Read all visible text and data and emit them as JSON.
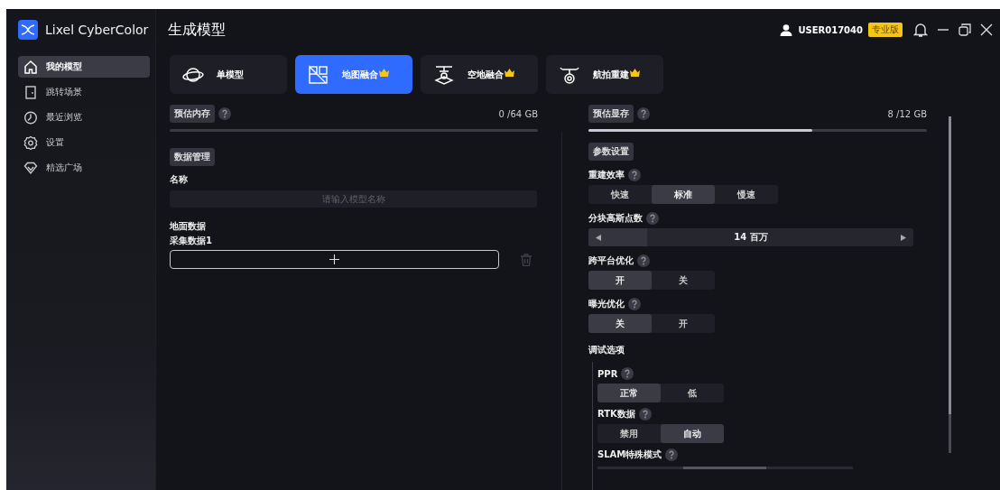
{
  "app": {
    "name": "Lixel CyberColor"
  },
  "page_title": "生成模型",
  "user": {
    "name": "USER017040",
    "badge": "专业版"
  },
  "sidebar": {
    "items": [
      {
        "label": "我的模型",
        "selected": true
      },
      {
        "label": "跳转场景",
        "selected": false
      },
      {
        "label": "最近浏览",
        "selected": false
      },
      {
        "label": "设置",
        "selected": false
      },
      {
        "label": "精选广场",
        "selected": false
      }
    ]
  },
  "mode_tabs": [
    {
      "label": "单模型",
      "selected": false,
      "premium": false
    },
    {
      "label": "地图融合",
      "selected": true,
      "premium": true
    },
    {
      "label": "空地融合",
      "selected": false,
      "premium": true
    },
    {
      "label": "航拍重建",
      "selected": false,
      "premium": true
    }
  ],
  "memory": {
    "label": "预估内存",
    "reading": "0 /64 GB"
  },
  "vram": {
    "label": "预估显存",
    "reading": "8 /12 GB",
    "level": 0.66
  },
  "data_section": {
    "label": "数据管理",
    "name_label": "名称",
    "name_placeholder": "请输入模型名称",
    "map_data_label": "地面数据",
    "collection_label": "采集数据1"
  },
  "params": {
    "label": "参数设置",
    "settings": [
      {
        "kind": "segmented",
        "label": "重建效率",
        "options": [
          {
            "label": "快速",
            "selected": false
          },
          {
            "label": "标准",
            "selected": true
          },
          {
            "label": "慢速",
            "selected": false
          }
        ]
      },
      {
        "kind": "stepper",
        "label": "分块高斯点数",
        "value": "14 百万",
        "level": 0.18
      },
      {
        "kind": "segmented",
        "label": "跨平台优化",
        "options": [
          {
            "label": "开",
            "selected": true
          },
          {
            "label": "关",
            "selected": false
          }
        ]
      },
      {
        "kind": "segmented",
        "label": "曝光优化",
        "options": [
          {
            "label": "关",
            "selected": true
          },
          {
            "label": "开",
            "selected": false
          }
        ]
      }
    ],
    "debug": {
      "label": "调试选项",
      "settings": [
        {
          "kind": "segmented",
          "label": "PPR",
          "options": [
            {
              "label": "正常",
              "selected": true
            },
            {
              "label": "低",
              "selected": false
            }
          ]
        },
        {
          "kind": "segmented",
          "label": "RTK数据",
          "options": [
            {
              "label": "禁用",
              "selected": false
            },
            {
              "label": "自动",
              "selected": true
            }
          ]
        },
        {
          "kind": "cut",
          "label": "SLAM特殊模式"
        }
      ]
    }
  }
}
